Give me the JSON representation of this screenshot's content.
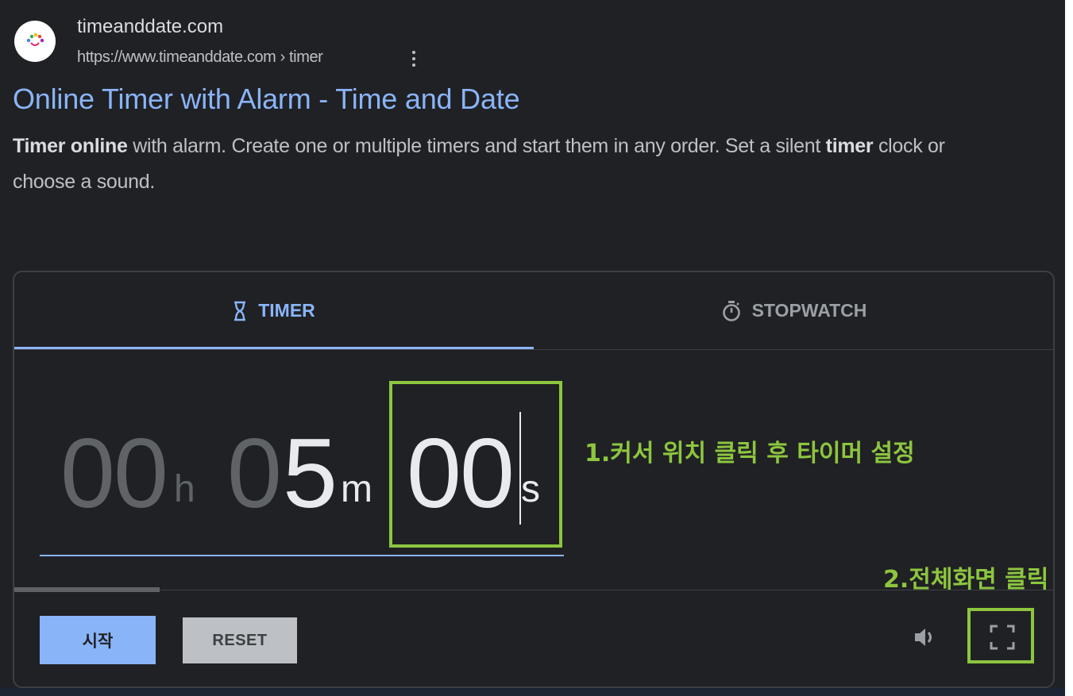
{
  "search_result": {
    "site_name": "timeanddate.com",
    "url": "https://www.timeanddate.com › timer",
    "title": "Online Timer with Alarm - Time and Date",
    "snippet": {
      "part1": "Timer online",
      "part2": " with alarm. Create one or multiple timers and start them in any order. Set a silent ",
      "part3": "timer",
      "part4": " clock or choose a sound."
    },
    "favicon": "timeanddate-logo-icon",
    "menu_icon": "more-vert-icon"
  },
  "timer_widget": {
    "tabs": [
      {
        "label": "TIMER",
        "icon": "hourglass-icon",
        "active": true
      },
      {
        "label": "STOPWATCH",
        "icon": "stopwatch-icon",
        "active": false
      }
    ],
    "time": {
      "hours": "00",
      "hours_unit": "h",
      "minutes_dim": "0",
      "minutes_bright": "5",
      "minutes_unit": "m",
      "seconds": "00",
      "seconds_unit": "s"
    },
    "progress": 0.14,
    "buttons": {
      "start": "시작",
      "reset": "RESET"
    },
    "icons": {
      "volume": "volume-icon",
      "fullscreen": "fullscreen-icon"
    }
  },
  "annotations": {
    "step1": "1.커서 위치 클릭 후 타이머 설정",
    "step2": "2.전체화면 클릭",
    "color": "#8dc63f"
  },
  "colors": {
    "background": "#202124",
    "link": "#8ab4f8",
    "accent": "#8ab4f8"
  }
}
